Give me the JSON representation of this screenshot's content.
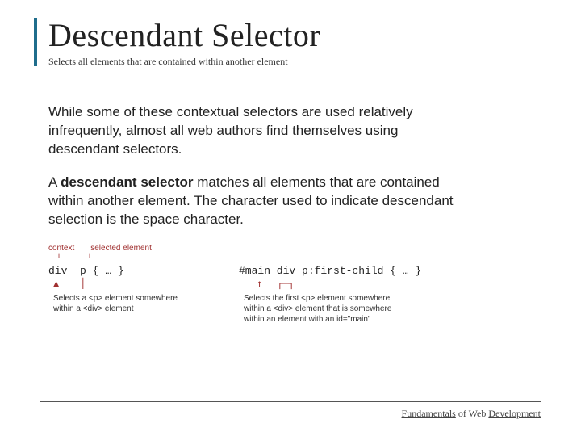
{
  "title": "Descendant Selector",
  "subtitle": "Selects all elements that are contained within another element",
  "para1": "While some of these contextual selectors are used relatively infrequently, almost all web authors find themselves using descendant selectors.",
  "para2_pre": "A ",
  "para2_term": "descendant selector",
  "para2_post": " matches all elements that are contained within another element. The character used to indicate descendant selection is the space character.",
  "ex1": {
    "label_context": "context",
    "label_selected": "selected element",
    "tick": "┴",
    "code": "div  p { … }",
    "arrow": "▲",
    "pipe": "│",
    "explain": "Selects a <p> element somewhere within a <div> element"
  },
  "ex2": {
    "code": "#main div p:first-child { … }",
    "arrow": "↑",
    "bracket": "┌─┐",
    "explain": "Selects the first <p> element somewhere within a <div> element that is somewhere within an element with an id=\"main\""
  },
  "footer": {
    "word1": "Fundamentals",
    "word2": " of Web ",
    "word3": "Development"
  }
}
